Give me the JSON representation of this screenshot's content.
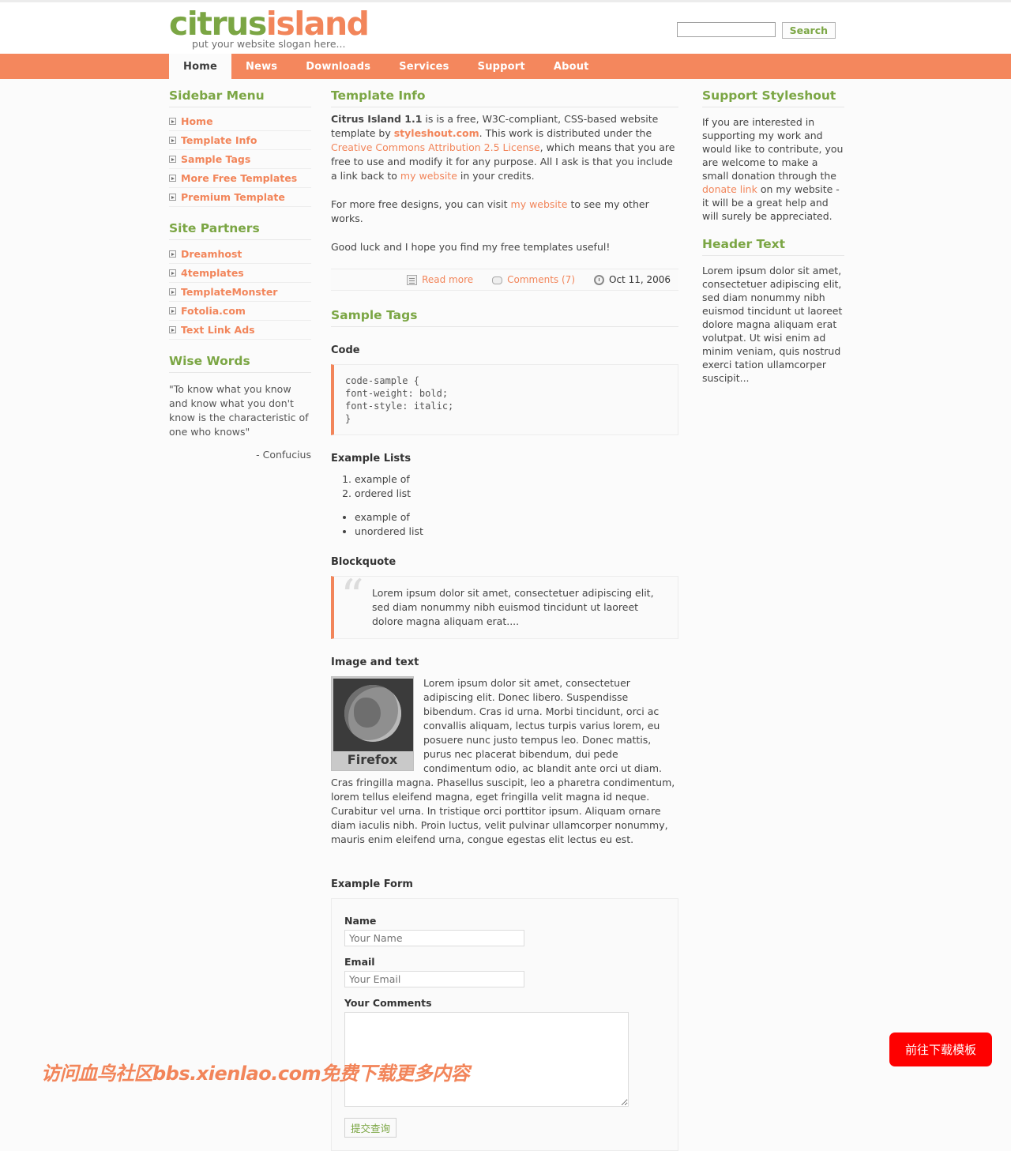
{
  "header": {
    "logo_part1": "citrus",
    "logo_part2": "island",
    "slogan": "put your website slogan here...",
    "search": {
      "value": "",
      "placeholder": "",
      "button_label": "Search"
    }
  },
  "nav": {
    "items": [
      {
        "label": "Home",
        "active": true
      },
      {
        "label": "News",
        "active": false
      },
      {
        "label": "Downloads",
        "active": false
      },
      {
        "label": "Services",
        "active": false
      },
      {
        "label": "Support",
        "active": false
      },
      {
        "label": "About",
        "active": false
      }
    ]
  },
  "sidebar_left": {
    "menu_title": "Sidebar Menu",
    "menu_items": [
      {
        "label": "Home"
      },
      {
        "label": "Template Info"
      },
      {
        "label": "Sample Tags"
      },
      {
        "label": "More Free Templates"
      },
      {
        "label": "Premium Template"
      }
    ],
    "partners_title": "Site Partners",
    "partners_items": [
      {
        "label": "Dreamhost"
      },
      {
        "label": "4templates"
      },
      {
        "label": "TemplateMonster"
      },
      {
        "label": "Fotolia.com"
      },
      {
        "label": "Text Link Ads"
      }
    ],
    "wise_title": "Wise Words",
    "wise_quote": "\"To know what you know and know what you don't know is the characteristic of one who knows\"",
    "wise_author": "- Confucius"
  },
  "content": {
    "template_info_title": "Template Info",
    "para1": {
      "strong": "Citrus Island 1.1",
      "t1": " is is a free, W3C-compliant, CSS-based website template by ",
      "link1": "styleshout.com",
      "t2": ". This work is distributed under the ",
      "link2": "Creative Commons Attribution 2.5 License",
      "t3": ", which means that you are free to use and modify it for any purpose. All I ask is that you include a link back to ",
      "link3": "my website",
      "t4": " in your credits."
    },
    "para2": {
      "t1": "For more free designs, you can visit ",
      "link1": "my website",
      "t2": " to see my other works."
    },
    "para3": "Good luck and I hope you find my free templates useful!",
    "meta": {
      "read_more": "Read more",
      "comments": "Comments (7)",
      "date": "Oct 11, 2006"
    },
    "sample_tags_title": "Sample Tags",
    "code_title": "Code",
    "code_sample": "code-sample {\nfont-weight: bold;\nfont-style: italic;\n}",
    "lists_title": "Example Lists",
    "ordered_list": [
      "example of",
      "ordered list"
    ],
    "unordered_list": [
      "example of",
      "unordered list"
    ],
    "blockquote_title": "Blockquote",
    "blockquote_text": "Lorem ipsum dolor sit amet, consectetuer adipiscing elit, sed diam nonummy nibh euismod tincidunt ut laoreet dolore magna aliquam erat....",
    "image_text_title": "Image and text",
    "image_label": "Firefox",
    "image_body": "Lorem ipsum dolor sit amet, consectetuer adipiscing elit. Donec libero. Suspendisse bibendum. Cras id urna. Morbi tincidunt, orci ac convallis aliquam, lectus turpis varius lorem, eu posuere nunc justo tempus leo. Donec mattis, purus nec placerat bibendum, dui pede condimentum odio, ac blandit ante orci ut diam. Cras fringilla magna. Phasellus suscipit, leo a pharetra condimentum, lorem tellus eleifend magna, eget fringilla velit magna id neque. Curabitur vel urna. In tristique orci porttitor ipsum. Aliquam ornare diam iaculis nibh. Proin luctus, velit pulvinar ullamcorper nonummy, mauris enim eleifend urna, congue egestas elit lectus eu est.",
    "form_title": "Example Form",
    "form": {
      "name_label": "Name",
      "name_placeholder": "Your Name",
      "name_value": "",
      "email_label": "Email",
      "email_placeholder": "Your Email",
      "email_value": "",
      "comments_label": "Your Comments",
      "comments_value": "",
      "submit_label": "提交查询"
    }
  },
  "sidebar_right": {
    "support_title": "Support Styleshout",
    "support_para": {
      "t1": "If you are interested in supporting my work and would like to contribute, you are welcome to make a small donation through the ",
      "link1": "donate link",
      "t2": " on my website - it will be a great help and will surely be appreciated."
    },
    "header_text_title": "Header Text",
    "header_text_para": "Lorem ipsum dolor sit amet, consectetuer adipiscing elit, sed diam nonummy nibh euismod tincidunt ut laoreet dolore magna aliquam erat volutpat. Ut wisi enim ad minim veniam, quis nostrud exerci tation ullamcorper suscipit..."
  },
  "overlay": {
    "watermark": "访问血鸟社区bbs.xienlao.com免费下载更多内容",
    "download_button": "前往下载模板"
  },
  "colors": {
    "accent_orange": "#f2855a",
    "accent_green": "#7ba644",
    "nav_bg": "#f4875d",
    "page_bg": "#fbfbfb",
    "float_button": "#fe0000"
  }
}
